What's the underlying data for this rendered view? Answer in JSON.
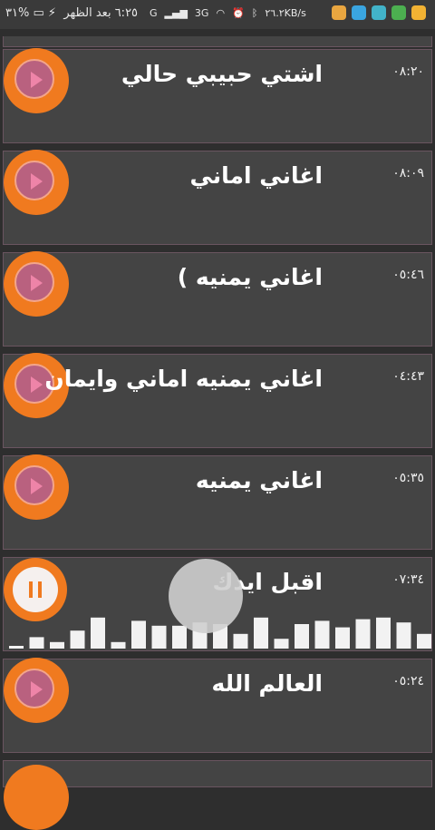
{
  "status_bar": {
    "time": "٦:٢٥ بعد الظهر",
    "battery": "%٣١",
    "speed": "٢٦.٢KB/s",
    "network_a": "G",
    "network_b": "3G"
  },
  "tracks": [
    {
      "title": "اشتي حبيبي حالي",
      "duration": "٠٨:٢٠",
      "playing": false
    },
    {
      "title": "اغاني اماني",
      "duration": "٠٨:٠٩",
      "playing": false
    },
    {
      "title": "اغاني يمنيه )",
      "duration": "٠٥:٤٦",
      "playing": false
    },
    {
      "title": "اغاني يمنيه  اماني وايمان",
      "duration": "٠٤:٤٣",
      "playing": false
    },
    {
      "title": "اغاني يمنيه",
      "duration": "٠٥:٣٥",
      "playing": false
    },
    {
      "title": "اقبل ايدك",
      "duration": "٠٧:٣٤",
      "playing": true
    },
    {
      "title": "العالم الله",
      "duration": "٠٥:٢٤",
      "playing": false
    }
  ],
  "visualizer_levels": [
    0.05,
    0.35,
    0.2,
    0.55,
    0.95,
    0.2,
    0.85,
    0.7,
    0.7,
    0.8,
    0.75,
    0.45,
    0.95,
    0.3,
    0.75,
    0.85,
    0.65,
    0.9,
    0.95,
    0.8,
    0.45,
    0.3,
    0.6
  ],
  "colors": {
    "accent": "#f07a1f",
    "row_bg": "#444444",
    "bg": "#2e2e2e"
  }
}
